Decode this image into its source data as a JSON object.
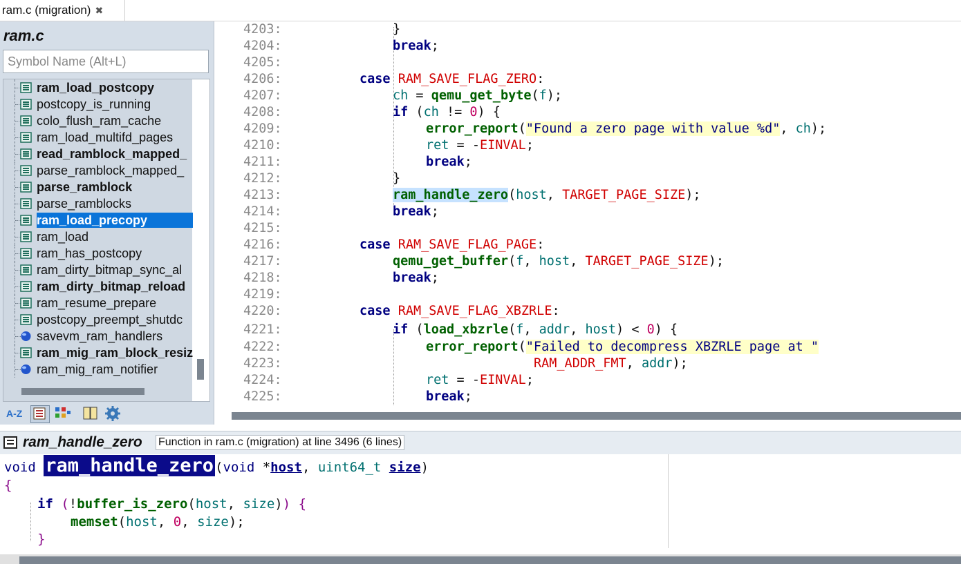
{
  "tab": {
    "label": "ram.c (migration)",
    "close": "✖"
  },
  "symbol_panel": {
    "file_title": "ram.c",
    "search_placeholder": "Symbol Name (Alt+L)",
    "items": [
      {
        "label": "ram_load_postcopy",
        "bold": true,
        "icon": "function-icon",
        "selected": false
      },
      {
        "label": "postcopy_is_running",
        "bold": false,
        "icon": "function-icon",
        "selected": false
      },
      {
        "label": "colo_flush_ram_cache",
        "bold": false,
        "icon": "function-icon",
        "selected": false
      },
      {
        "label": "ram_load_multifd_pages",
        "bold": false,
        "icon": "function-icon",
        "selected": false
      },
      {
        "label": "read_ramblock_mapped_",
        "bold": true,
        "icon": "function-icon",
        "selected": false
      },
      {
        "label": "parse_ramblock_mapped_",
        "bold": false,
        "icon": "function-icon",
        "selected": false
      },
      {
        "label": "parse_ramblock",
        "bold": true,
        "icon": "function-icon",
        "selected": false
      },
      {
        "label": "parse_ramblocks",
        "bold": false,
        "icon": "function-icon",
        "selected": false
      },
      {
        "label": "ram_load_precopy",
        "bold": true,
        "icon": "function-icon",
        "selected": true
      },
      {
        "label": "ram_load",
        "bold": false,
        "icon": "function-icon",
        "selected": false
      },
      {
        "label": "ram_has_postcopy",
        "bold": false,
        "icon": "function-icon",
        "selected": false
      },
      {
        "label": "ram_dirty_bitmap_sync_al",
        "bold": false,
        "icon": "function-icon",
        "selected": false
      },
      {
        "label": "ram_dirty_bitmap_reload",
        "bold": true,
        "icon": "function-icon",
        "selected": false
      },
      {
        "label": "ram_resume_prepare",
        "bold": false,
        "icon": "function-icon",
        "selected": false
      },
      {
        "label": "postcopy_preempt_shutdc",
        "bold": false,
        "icon": "function-icon",
        "selected": false
      },
      {
        "label": "savevm_ram_handlers",
        "bold": false,
        "icon": "variable-icon",
        "selected": false
      },
      {
        "label": "ram_mig_ram_block_resiz",
        "bold": true,
        "icon": "function-icon",
        "selected": false
      },
      {
        "label": "ram_mig_ram_notifier",
        "bold": false,
        "icon": "variable-icon",
        "selected": false
      }
    ],
    "toolbar": [
      "sort-az-icon",
      "list-view-icon",
      "category-icon",
      "book-icon",
      "settings-gear-icon"
    ],
    "sort_label": "A-Z"
  },
  "editor": {
    "lines": [
      {
        "num": "4203:",
        "code": ""
      },
      {
        "num": "4204:",
        "code": ""
      },
      {
        "num": "4205:",
        "code": ""
      },
      {
        "num": "4206:",
        "code": ""
      },
      {
        "num": "4207:",
        "code": ""
      },
      {
        "num": "4208:",
        "code": ""
      },
      {
        "num": "4209:",
        "code": ""
      },
      {
        "num": "4210:",
        "code": ""
      },
      {
        "num": "4211:",
        "code": ""
      },
      {
        "num": "4212:",
        "code": ""
      },
      {
        "num": "4213:",
        "code": ""
      },
      {
        "num": "4214:",
        "code": ""
      },
      {
        "num": "4215:",
        "code": ""
      },
      {
        "num": "4216:",
        "code": ""
      },
      {
        "num": "4217:",
        "code": ""
      },
      {
        "num": "4218:",
        "code": ""
      },
      {
        "num": "4219:",
        "code": ""
      },
      {
        "num": "4220:",
        "code": ""
      },
      {
        "num": "4221:",
        "code": ""
      },
      {
        "num": "4222:",
        "code": ""
      },
      {
        "num": "4223:",
        "code": ""
      },
      {
        "num": "4224:",
        "code": ""
      },
      {
        "num": "4225:",
        "code": ""
      }
    ],
    "tokens": {
      "l4203": "}",
      "l4204": "break",
      "l4206_kw": "case",
      "l4206_c": "RAM_SAVE_FLAG_ZERO",
      "l4207_v": "ch",
      "l4207_f": "qemu_get_byte",
      "l4207_a": "f",
      "l4208_kw": "if",
      "l4208_v": "ch",
      "l4208_op": "!=",
      "l4208_n": "0",
      "l4209_f": "error_report",
      "l4209_s": "\"Found a zero page with value %d\"",
      "l4209_v": "ch",
      "l4210_v": "ret",
      "l4210_c": "EINVAL",
      "l4211": "break",
      "l4212": "}",
      "l4213_f": "ram_handle_zero",
      "l4213_v": "host",
      "l4213_c": "TARGET_PAGE_SIZE",
      "l4214": "break",
      "l4216_kw": "case",
      "l4216_c": "RAM_SAVE_FLAG_PAGE",
      "l4217_f": "qemu_get_buffer",
      "l4217_a": "f",
      "l4217_v": "host",
      "l4217_c": "TARGET_PAGE_SIZE",
      "l4218": "break",
      "l4220_kw": "case",
      "l4220_c": "RAM_SAVE_FLAG_XBZRLE",
      "l4221_kw": "if",
      "l4221_f": "load_xbzrle",
      "l4221_a": "f",
      "l4221_v1": "addr",
      "l4221_v2": "host",
      "l4221_n": "0",
      "l4222_f": "error_report",
      "l4222_s": "\"Failed to decompress XBZRLE page at \"",
      "l4223_c": "RAM_ADDR_FMT",
      "l4223_v": "addr",
      "l4224_v": "ret",
      "l4224_c": "EINVAL",
      "l4225": "break"
    }
  },
  "context": {
    "title": "ram_handle_zero",
    "description": "Function in ram.c (migration) at line 3496 (6 lines)",
    "sig_void": "void",
    "sig_name": "ram_handle_zero",
    "sig_void2": "void",
    "sig_host": "host",
    "sig_type": "uint64_t",
    "sig_size": "size",
    "brace_open": "{",
    "if_kw": "if",
    "if_fn": "buffer_is_zero",
    "if_a1": "host",
    "if_a2": "size",
    "ms_fn": "memset",
    "ms_a1": "host",
    "ms_n": "0",
    "ms_a3": "size",
    "brace_close": "}"
  }
}
